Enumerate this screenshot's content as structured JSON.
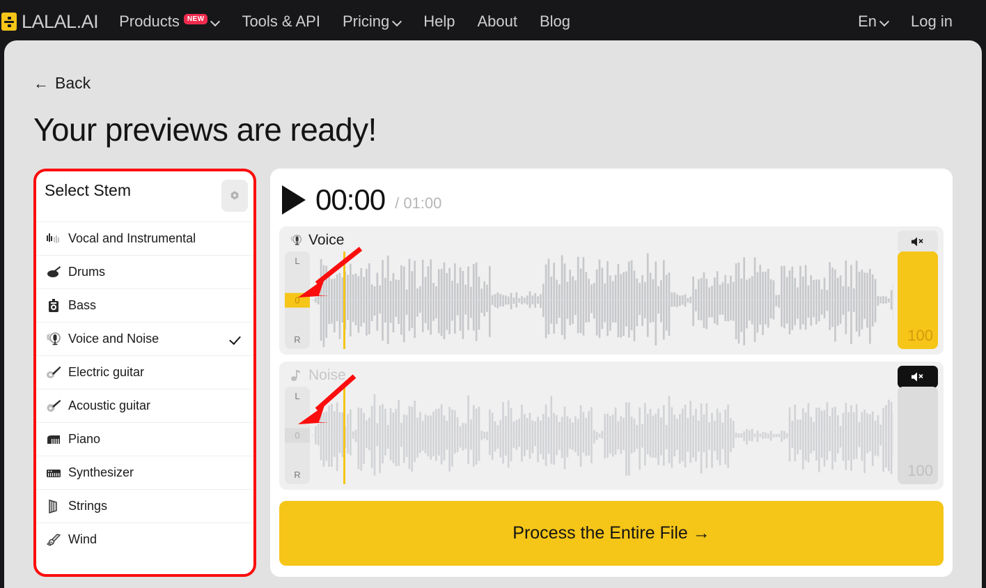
{
  "nav": {
    "logo_text": "LALAL.AI",
    "logo_icon": "lalal-logo-icon",
    "items": [
      {
        "label": "Products",
        "badge": "NEW",
        "has_chevron": true
      },
      {
        "label": "Tools & API",
        "badge": null,
        "has_chevron": false
      },
      {
        "label": "Pricing",
        "badge": null,
        "has_chevron": true
      },
      {
        "label": "Help",
        "badge": null,
        "has_chevron": false
      },
      {
        "label": "About",
        "badge": null,
        "has_chevron": false
      },
      {
        "label": "Blog",
        "badge": null,
        "has_chevron": false
      }
    ],
    "language": "En",
    "login": "Log in"
  },
  "page": {
    "back_label": "Back",
    "back_arrow": "←",
    "title": "Your previews are ready!"
  },
  "stem_panel": {
    "title": "Select Stem",
    "settings_icon": "gear-icon",
    "items": [
      {
        "label": "Vocal and Instrumental",
        "icon": "waveform-icon",
        "selected": false
      },
      {
        "label": "Drums",
        "icon": "drums-icon",
        "selected": false
      },
      {
        "label": "Bass",
        "icon": "bass-amp-icon",
        "selected": false
      },
      {
        "label": "Voice and Noise",
        "icon": "microphone-icon",
        "selected": true
      },
      {
        "label": "Electric guitar",
        "icon": "electric-guitar-icon",
        "selected": false
      },
      {
        "label": "Acoustic guitar",
        "icon": "acoustic-guitar-icon",
        "selected": false
      },
      {
        "label": "Piano",
        "icon": "piano-icon",
        "selected": false
      },
      {
        "label": "Synthesizer",
        "icon": "synthesizer-icon",
        "selected": false
      },
      {
        "label": "Strings",
        "icon": "strings-icon",
        "selected": false
      },
      {
        "label": "Wind",
        "icon": "wind-icon",
        "selected": false
      }
    ]
  },
  "player": {
    "play_icon": "play-icon",
    "current_time": "00:00",
    "total_time": "/ 01:00",
    "tracks": [
      {
        "name": "Voice",
        "icon": "microphone-icon",
        "muted": false,
        "volume": "100",
        "pan_labels": {
          "top": "L",
          "center": "0",
          "bottom": "R"
        },
        "mute_icon": "speaker-mute-icon"
      },
      {
        "name": "Noise",
        "icon": "noise-note-icon",
        "muted": true,
        "volume": "100",
        "pan_labels": {
          "top": "L",
          "center": "0",
          "bottom": "R"
        },
        "mute_icon": "speaker-mute-icon"
      }
    ],
    "process_button": "Process the Entire File →"
  },
  "colors": {
    "accent_yellow": "#f5c518",
    "annotation_red": "#fb0d0d",
    "nav_background": "#17171a",
    "page_background": "#e2e2e2"
  }
}
